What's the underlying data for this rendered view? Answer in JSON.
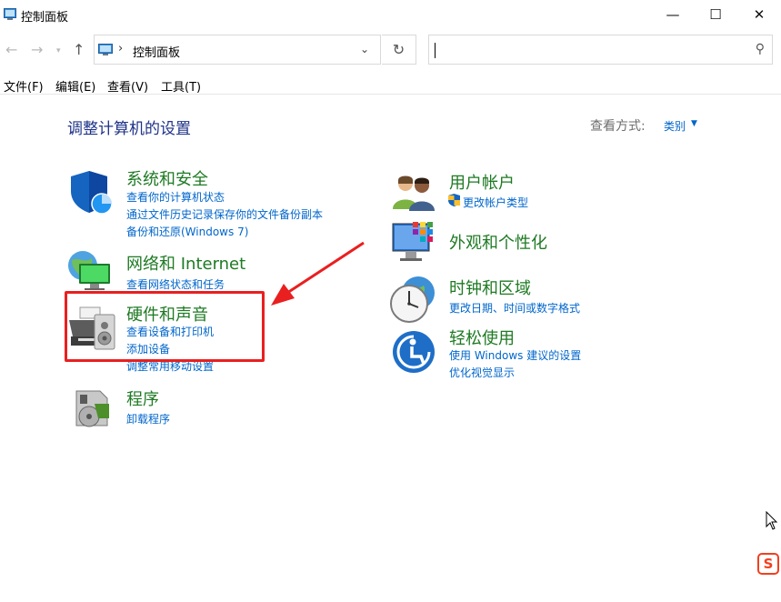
{
  "window": {
    "title": "控制面板",
    "minimize_glyph": "—",
    "maximize_glyph": "☐",
    "close_glyph": "✕"
  },
  "navigation": {
    "back_glyph": "←",
    "forward_glyph": "→",
    "recent_glyph": "▾",
    "up_glyph": "↑",
    "breadcrumb_separator": "›",
    "breadcrumb": "控制面板",
    "dropdown_glyph": "⌄",
    "refresh_glyph": "↻",
    "search_value": "",
    "search_icon_glyph": "⚲"
  },
  "menubar": {
    "items": [
      "文件(F)",
      "编辑(E)",
      "查看(V)",
      "工具(T)"
    ]
  },
  "content": {
    "heading": "调整计算机的设置",
    "view_by_label": "查看方式:",
    "view_by_value": "类别",
    "view_by_caret": "▼"
  },
  "categories": {
    "system": {
      "title": "系统和安全",
      "links": [
        "查看你的计算机状态",
        "通过文件历史记录保存你的文件备份副本",
        "备份和还原(Windows 7)"
      ]
    },
    "network": {
      "title": "网络和 Internet",
      "links": [
        "查看网络状态和任务"
      ]
    },
    "hardware": {
      "title": "硬件和声音",
      "links": [
        "查看设备和打印机",
        "添加设备",
        "调整常用移动设置"
      ]
    },
    "programs": {
      "title": "程序",
      "links": [
        "卸载程序"
      ]
    },
    "user": {
      "title": "用户帐户",
      "links": [
        "更改帐户类型"
      ]
    },
    "appearance": {
      "title": "外观和个性化",
      "links": []
    },
    "clock": {
      "title": "时钟和区域",
      "links": [
        "更改日期、时间或数字格式"
      ]
    },
    "ease": {
      "title": "轻松使用",
      "links": [
        "使用 Windows 建议的设置",
        "优化视觉显示"
      ]
    }
  },
  "tray": {
    "ime_label": "S"
  },
  "colors": {
    "category_title": "#1e7a23",
    "link": "#0066cc",
    "heading": "#1e3287",
    "annotation": "#ea1f1f"
  }
}
